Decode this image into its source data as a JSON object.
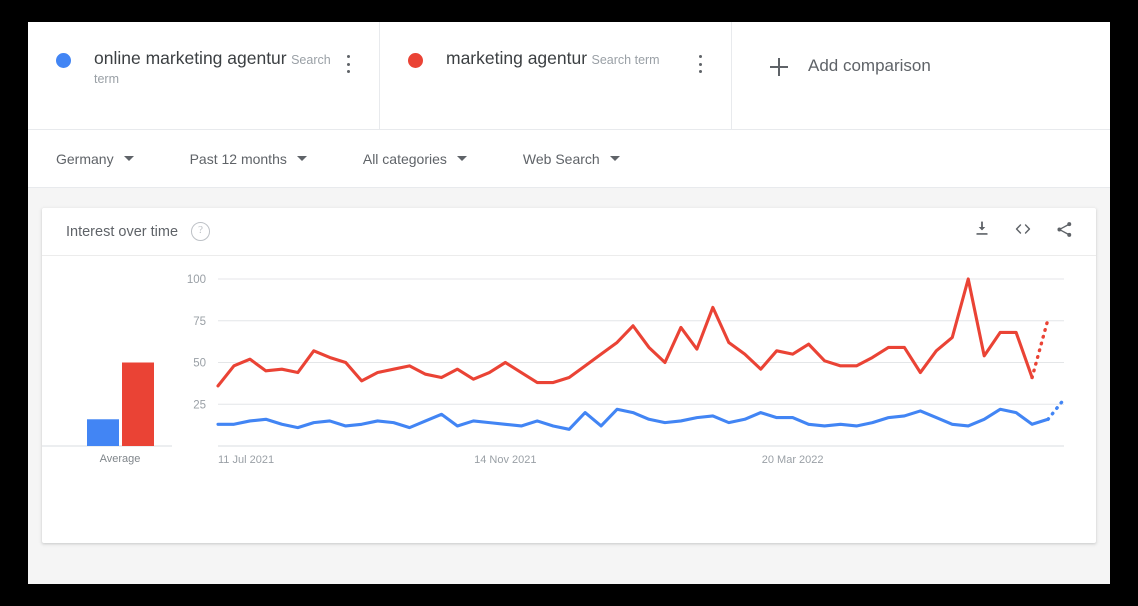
{
  "app": {
    "background_color": "#f5f5f5",
    "card_color": "#ffffff"
  },
  "terms": [
    {
      "name": "online marketing agentur",
      "subtitle": "Search term",
      "color": "#4285f4",
      "menu_icon": "kebab-menu-icon"
    },
    {
      "name": "marketing agentur",
      "subtitle": "Search term",
      "color": "#ea4335",
      "menu_icon": "kebab-menu-icon"
    }
  ],
  "add_comparison": {
    "label": "Add comparison",
    "icon": "plus-icon"
  },
  "filters": [
    {
      "label": "Germany",
      "icon": "chevron-down-icon"
    },
    {
      "label": "Past 12 months",
      "icon": "chevron-down-icon"
    },
    {
      "label": "All categories",
      "icon": "chevron-down-icon"
    },
    {
      "label": "Web Search",
      "icon": "chevron-down-icon"
    }
  ],
  "chart_card": {
    "title": "Interest over time",
    "help_icon": "question-mark-icon",
    "help_glyph": "?",
    "actions": [
      {
        "name": "download-icon",
        "tooltip": "Download"
      },
      {
        "name": "embed-code-icon",
        "tooltip": "Embed"
      },
      {
        "name": "share-icon",
        "tooltip": "Share"
      }
    ]
  },
  "chart_data": {
    "type": "line",
    "title": "Interest over time",
    "xlabel": "",
    "ylabel": "",
    "ylim": [
      0,
      100
    ],
    "yticks": [
      25,
      50,
      75,
      100
    ],
    "ytick_labels": [
      "25",
      "50",
      "75",
      "100"
    ],
    "grid": true,
    "legend_position": "top",
    "xtick_labels": [
      "11 Jul 2021",
      "14 Nov 2021",
      "20 Mar 2022"
    ],
    "xtick_indices": [
      0,
      18,
      36
    ],
    "colors": {
      "online marketing agentur": "#4285f4",
      "marketing agentur": "#ea4335"
    },
    "partial_last_point": true,
    "series": [
      {
        "name": "online marketing agentur",
        "color": "#4285f4",
        "values": [
          13,
          13,
          15,
          16,
          13,
          11,
          14,
          15,
          12,
          13,
          15,
          14,
          11,
          15,
          19,
          12,
          15,
          14,
          13,
          12,
          15,
          12,
          10,
          20,
          12,
          22,
          20,
          16,
          14,
          15,
          17,
          18,
          14,
          16,
          20,
          17,
          17,
          13,
          12,
          13,
          12,
          14,
          17,
          18,
          21,
          17,
          13,
          12,
          16,
          22,
          20,
          13,
          16,
          28
        ]
      },
      {
        "name": "marketing agentur",
        "color": "#ea4335",
        "values": [
          36,
          48,
          52,
          45,
          46,
          44,
          57,
          53,
          50,
          39,
          44,
          46,
          48,
          43,
          41,
          46,
          40,
          44,
          50,
          44,
          38,
          38,
          41,
          48,
          55,
          62,
          72,
          59,
          50,
          71,
          58,
          83,
          62,
          55,
          46,
          57,
          55,
          61,
          51,
          48,
          48,
          53,
          59,
          59,
          44,
          57,
          65,
          100,
          54,
          68,
          68,
          41,
          76
        ]
      }
    ],
    "average_bars": {
      "label": "Average",
      "values": [
        {
          "name": "online marketing agentur",
          "value": 16,
          "color": "#4285f4"
        },
        {
          "name": "marketing agentur",
          "value": 50,
          "color": "#ea4335"
        }
      ]
    }
  }
}
